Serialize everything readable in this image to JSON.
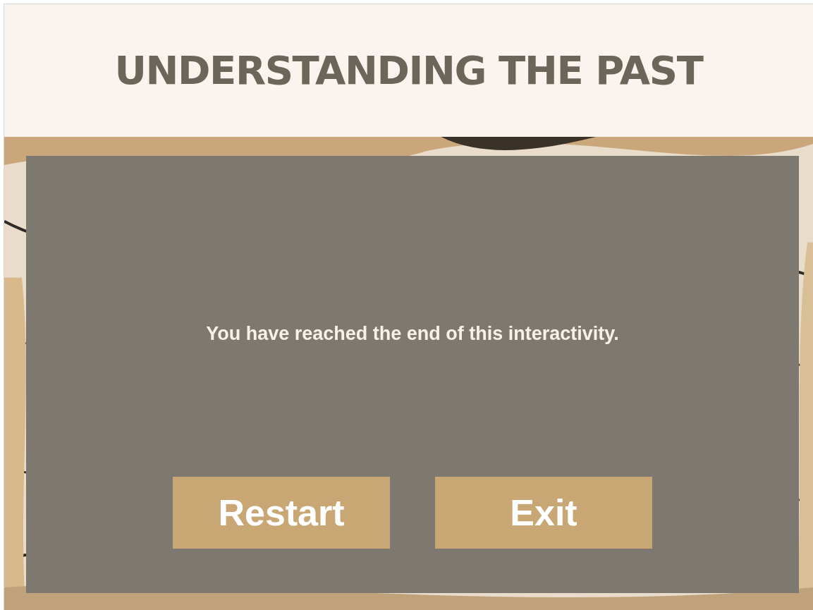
{
  "header": {
    "title": "UNDERSTANDING THE PAST"
  },
  "panel": {
    "message": "You have reached the end of this interactivity.",
    "buttons": [
      {
        "label": "Restart"
      },
      {
        "label": "Exit"
      }
    ]
  }
}
